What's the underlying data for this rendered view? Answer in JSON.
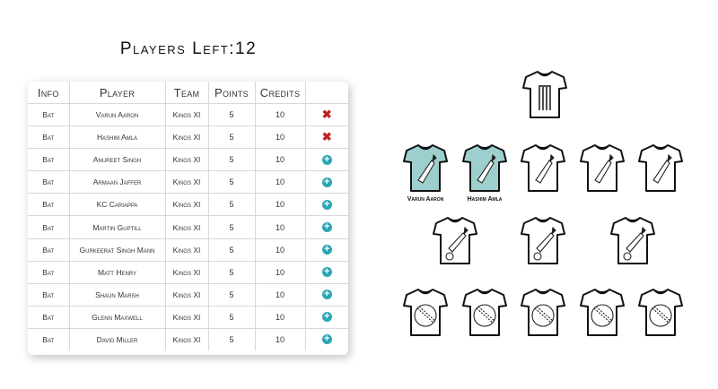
{
  "header": {
    "players_left_label": "Players Left:",
    "players_left_count": "12"
  },
  "table": {
    "columns": [
      "Info",
      "Player",
      "Team",
      "Points",
      "Credits",
      ""
    ],
    "rows": [
      {
        "info": "Bat",
        "player": "Varun Aaron",
        "team": "Kings XI",
        "points": "5",
        "credits": "10",
        "action": "remove"
      },
      {
        "info": "Bat",
        "player": "Hashim Amla",
        "team": "Kings XI",
        "points": "5",
        "credits": "10",
        "action": "remove"
      },
      {
        "info": "Bat",
        "player": "Anureet Singh",
        "team": "Kings XI",
        "points": "5",
        "credits": "10",
        "action": "add"
      },
      {
        "info": "Bat",
        "player": "Armaan Jaffer",
        "team": "Kings XI",
        "points": "5",
        "credits": "10",
        "action": "add"
      },
      {
        "info": "Bat",
        "player": "KC Cariappa",
        "team": "Kings XI",
        "points": "5",
        "credits": "10",
        "action": "add"
      },
      {
        "info": "Bat",
        "player": "Martin Guptill",
        "team": "Kings XI",
        "points": "5",
        "credits": "10",
        "action": "add"
      },
      {
        "info": "Bat",
        "player": "Gurkeerat Singh Mann",
        "team": "Kings XI",
        "points": "5",
        "credits": "10",
        "action": "add"
      },
      {
        "info": "Bat",
        "player": "Matt Henry",
        "team": "Kings XI",
        "points": "5",
        "credits": "10",
        "action": "add"
      },
      {
        "info": "Bat",
        "player": "Shaun Marsh",
        "team": "Kings XI",
        "points": "5",
        "credits": "10",
        "action": "add"
      },
      {
        "info": "Bat",
        "player": "Glenn Maxwell",
        "team": "Kings XI",
        "points": "5",
        "credits": "10",
        "action": "add"
      },
      {
        "info": "Bat",
        "player": "David Miller",
        "team": "Kings XI",
        "points": "5",
        "credits": "10",
        "action": "add"
      }
    ]
  },
  "field": {
    "selected_color": "#9ecfcf",
    "accent_add": "#2ba6b5",
    "accent_remove": "#c0221e",
    "slots": [
      {
        "role": "wicketkeeper",
        "icon": "stumps-icon",
        "filled": false,
        "name": ""
      },
      {
        "role": "batsman",
        "icon": "bat-icon",
        "filled": true,
        "name": "Varun Aaron"
      },
      {
        "role": "batsman",
        "icon": "bat-icon",
        "filled": true,
        "name": "Hashim Amla"
      },
      {
        "role": "batsman",
        "icon": "bat-icon",
        "filled": false,
        "name": ""
      },
      {
        "role": "batsman",
        "icon": "bat-icon",
        "filled": false,
        "name": ""
      },
      {
        "role": "batsman",
        "icon": "bat-icon",
        "filled": false,
        "name": ""
      },
      {
        "role": "allrounder",
        "icon": "bat-ball-icon",
        "filled": false,
        "name": ""
      },
      {
        "role": "allrounder",
        "icon": "bat-ball-icon",
        "filled": false,
        "name": ""
      },
      {
        "role": "allrounder",
        "icon": "bat-ball-icon",
        "filled": false,
        "name": ""
      },
      {
        "role": "bowler",
        "icon": "ball-icon",
        "filled": false,
        "name": ""
      },
      {
        "role": "bowler",
        "icon": "ball-icon",
        "filled": false,
        "name": ""
      },
      {
        "role": "bowler",
        "icon": "ball-icon",
        "filled": false,
        "name": ""
      },
      {
        "role": "bowler",
        "icon": "ball-icon",
        "filled": false,
        "name": ""
      },
      {
        "role": "bowler",
        "icon": "ball-icon",
        "filled": false,
        "name": ""
      }
    ]
  }
}
